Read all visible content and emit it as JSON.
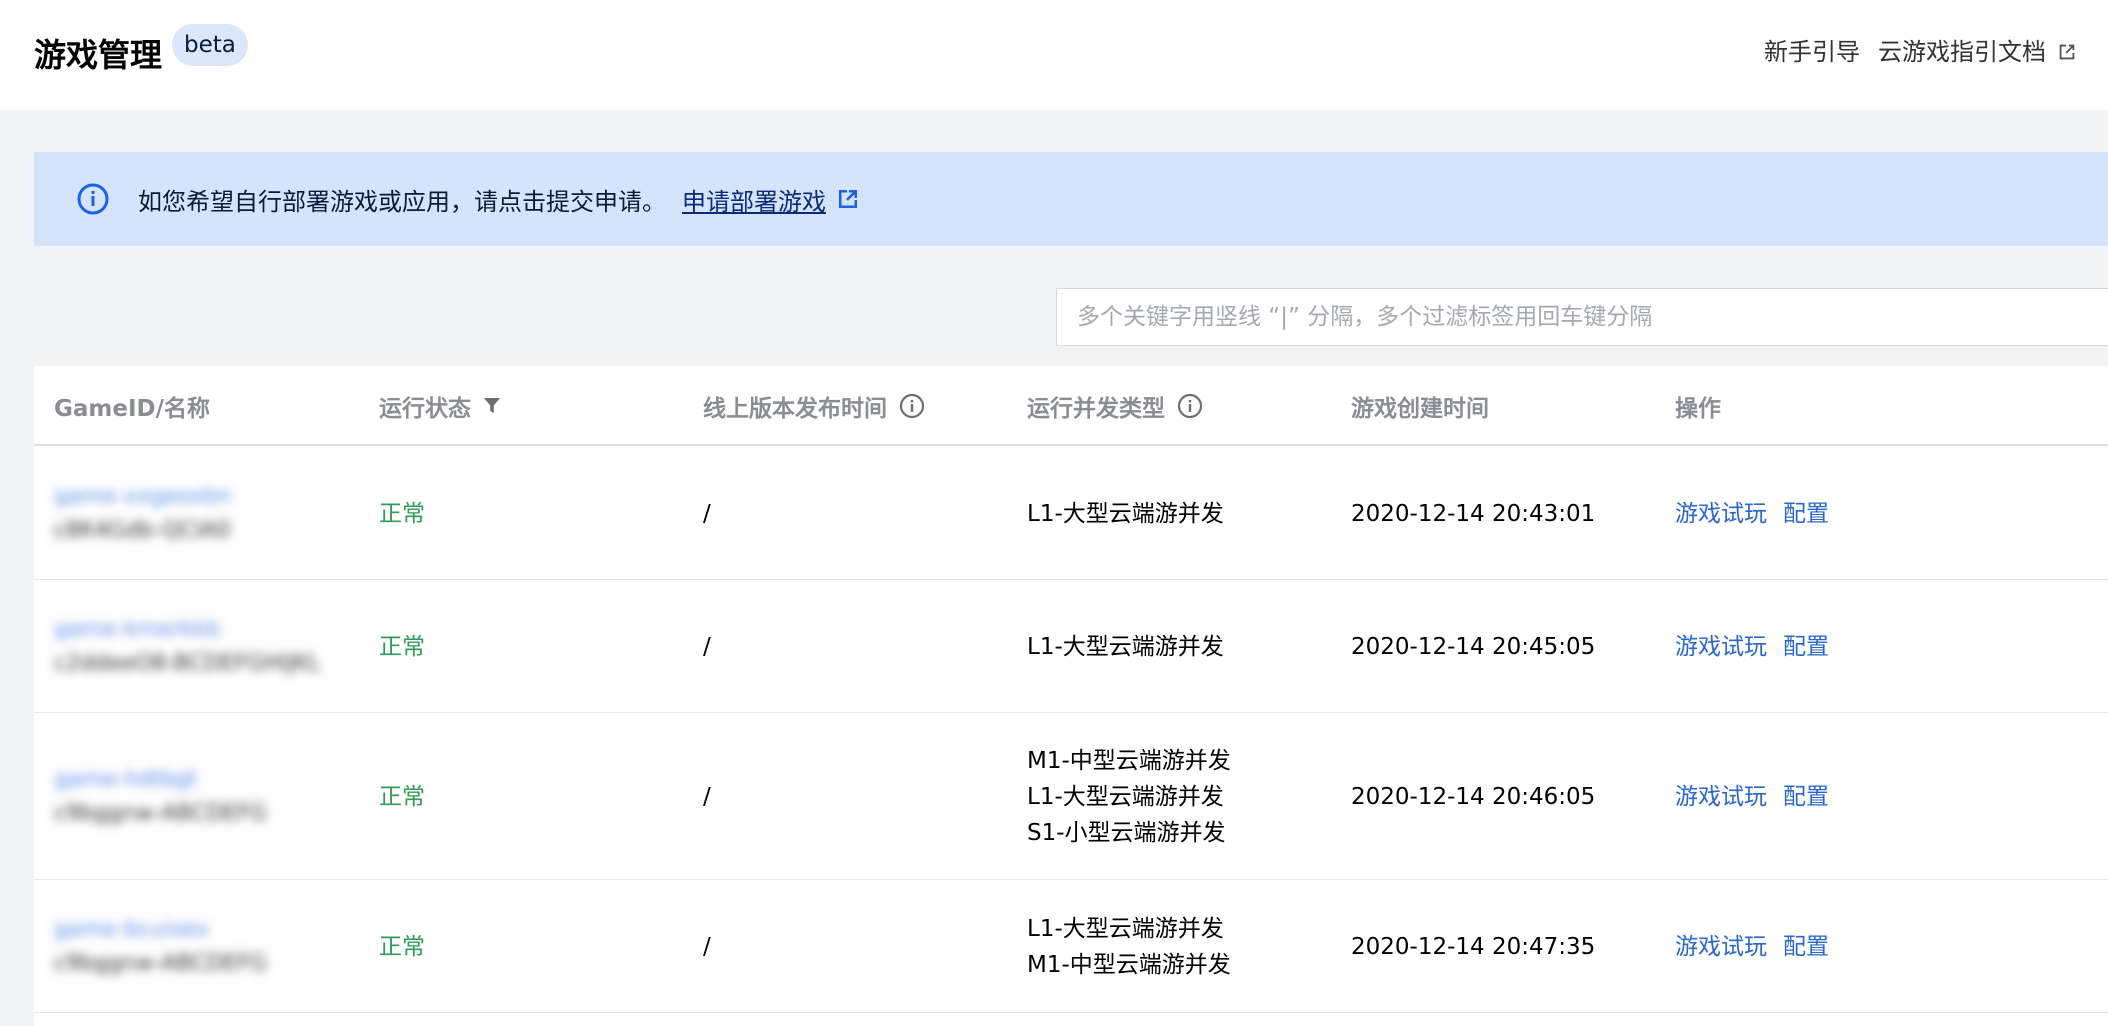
{
  "header": {
    "title": "游戏管理",
    "badge": "beta",
    "links": {
      "guide": "新手引导",
      "docs": "云游戏指引文档"
    }
  },
  "notice": {
    "text": "如您希望自行部署游戏或应用，请点击提交申请。",
    "link": "申请部署游戏"
  },
  "search": {
    "placeholder": "多个关键字用竖线 “|” 分隔，多个过滤标签用回车键分隔"
  },
  "table": {
    "columns": [
      "GameID/名称",
      "运行状态",
      "线上版本发布时间",
      "运行并发类型",
      "游戏创建时间",
      "操作"
    ],
    "actions": {
      "trial": "游戏试玩",
      "config": "配置"
    },
    "rows": [
      {
        "id": "game-xxgeoxbn",
        "name": "c8K4Gdb-QCIA0",
        "status": "正常",
        "release_time": "/",
        "concurrency": [
          "L1-大型云端游并发"
        ],
        "created": "2020-12-14 20:43:01"
      },
      {
        "id": "game-kmerkkb",
        "name": "c2ddeeO8-BCDEFGHIJKL",
        "status": "正常",
        "release_time": "/",
        "concurrency": [
          "L1-大型云端游并发"
        ],
        "created": "2020-12-14 20:45:05"
      },
      {
        "id": "game-hdtbgt",
        "name": "c9bggnw-ABCDEFG",
        "status": "正常",
        "release_time": "/",
        "concurrency": [
          "M1-中型云端游并发",
          "L1-大型云端游并发",
          "S1-小型云端游并发"
        ],
        "created": "2020-12-14 20:46:05"
      },
      {
        "id": "game-bcuixex",
        "name": "c9bggnw-ABCDEFG",
        "status": "正常",
        "release_time": "/",
        "concurrency": [
          "L1-大型云端游并发",
          "M1-中型云端游并发"
        ],
        "created": "2020-12-14 20:47:35"
      }
    ]
  },
  "colors": {
    "link": "#2a67c9",
    "status_normal": "#2f9b55",
    "notice_bg": "#d6e4fb",
    "badge_bg": "#dbe7fb"
  },
  "icons": {
    "notice": "info-circle-icon",
    "external": "external-link-icon",
    "filter": "filter-funnel-icon",
    "info": "info-circle-icon"
  }
}
